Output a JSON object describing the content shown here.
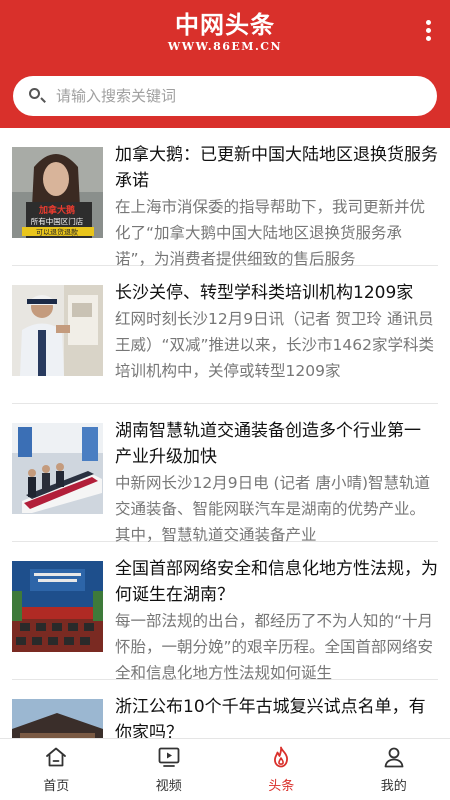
{
  "header": {
    "title": "中网头条",
    "url": "WWW.86EM.CN"
  },
  "search": {
    "placeholder": "请输入搜索关键词"
  },
  "feed": [
    {
      "title": "加拿大鹅：已更新中国大陆地区退换货服务承诺",
      "summary": "在上海市消保委的指导帮助下，我司更新并优化了“加拿大鹅中国大陆地区退换货服务承诺”，为消费者提供细致的售后服务",
      "thumb_caption_1": "加拿大鹅",
      "thumb_caption_2": "所有中国区门店",
      "thumb_caption_3": "可以退货退款"
    },
    {
      "title": "长沙关停、转型学科类培训机构1209家",
      "summary": "红网时刻长沙12月9日讯（记者 贺卫玲 通讯员 王威）“双减”推进以来，长沙市1462家学科类培训机构中，关停或转型1209家"
    },
    {
      "title": "湖南智慧轨道交通装备创造多个行业第一 产业升级加快",
      "summary": "中新网长沙12月9日电 (记者 唐小晴)智慧轨道交通装备、智能网联汽车是湖南的优势产业。其中，智慧轨道交通装备产业"
    },
    {
      "title": "全国首部网络安全和信息化地方性法规，为何诞生在湖南？",
      "summary": "每一部法规的出台，都经历了不为人知的“十月怀胎，一朝分娩”的艰辛历程。全国首部网络安全和信息化地方性法规如何诞生"
    },
    {
      "title": "浙江公布10个千年古城复兴试点名单，有你家吗？",
      "summary": ""
    }
  ],
  "tabs": [
    {
      "label": "首页",
      "icon": "home-icon"
    },
    {
      "label": "视频",
      "icon": "video-icon"
    },
    {
      "label": "头条",
      "icon": "flame-icon"
    },
    {
      "label": "我的",
      "icon": "user-icon"
    }
  ],
  "colors": {
    "brand_red": "#d9302b",
    "active_tab": "#d9302b"
  }
}
